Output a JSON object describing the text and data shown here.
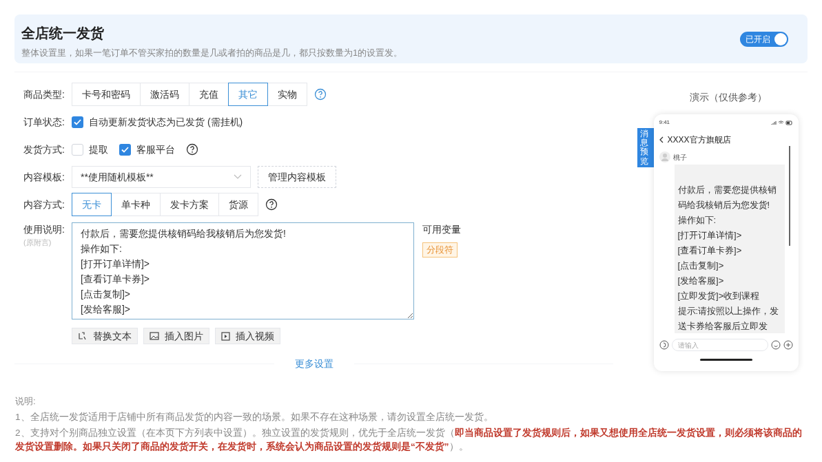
{
  "header": {
    "title": "全店统一发货",
    "subtitle": "整体设置里，如果一笔订单不管买家拍的数量是几或者拍的商品是几，都只按数量为1的设置发。",
    "toggle": {
      "label": "已开启",
      "on": true
    }
  },
  "form": {
    "product_type": {
      "label": "商品类型:",
      "options": [
        {
          "label": "卡号和密码",
          "selected": false
        },
        {
          "label": "激活码",
          "selected": false
        },
        {
          "label": "充值",
          "selected": false
        },
        {
          "label": "其它",
          "selected": true
        },
        {
          "label": "实物",
          "selected": false
        }
      ]
    },
    "order_status": {
      "label": "订单状态:",
      "checkbox": {
        "label": "自动更新发货状态为已发货 (需挂机)",
        "checked": true
      }
    },
    "delivery_method": {
      "label": "发货方式:",
      "checkboxes": [
        {
          "label": "提取",
          "checked": false
        },
        {
          "label": "客服平台",
          "checked": true
        }
      ]
    },
    "content_template": {
      "label": "内容模板:",
      "value": "**使用随机模板**",
      "manage_button": "管理内容模板"
    },
    "content_mode": {
      "label": "内容方式:",
      "options": [
        {
          "label": "无卡",
          "selected": true
        },
        {
          "label": "单卡种",
          "selected": false
        },
        {
          "label": "发卡方案",
          "selected": false
        },
        {
          "label": "货源",
          "selected": false
        }
      ]
    },
    "instructions": {
      "label": "使用说明:",
      "sublabel": "(原附言)",
      "value": "付款后，需要您提供核销码给我核销后为您发货!\n操作如下:\n[打开订单详情]>\n[查看订单卡券]>\n[点击复制]>\n[发给客服]>",
      "variables_title": "可用变量",
      "variables": [
        "分段符"
      ],
      "buttons": [
        {
          "kind": "replace",
          "label": "替换文本"
        },
        {
          "kind": "image",
          "label": "插入图片"
        },
        {
          "kind": "video",
          "label": "插入视频"
        }
      ]
    },
    "more_settings": "更多设置"
  },
  "preview": {
    "title": "演示（仅供参考）",
    "side_tab": "消息预览",
    "time": "9:41",
    "shop": "XXXX官方旗舰店",
    "sender": "桃子",
    "message": [
      "付款后，需要您提供核销码给我核销后为您发货!",
      "操作如下:",
      "[打开订单详情]>",
      "[查看订单卡券]>",
      "[点击复制]>",
      "[发给客服]>",
      "[立即发货]>收到课程",
      "提示:请按照以上操作，发送卡券给客服后立即发"
    ],
    "input_placeholder": "请输入"
  },
  "notes": {
    "title": "说明:",
    "items": [
      "1、全店统一发货适用于店铺中所有商品发货的内容一致的场景。如果不存在这种场景，请勿设置全店统一发货。",
      "2、支持对个别商品独立设置（在本页下方列表中设置）。独立设置的发货规则，优先于全店统一发货（**即当商品设置了发货规则后，如果又想使用全店统一发货设置，则必须将该商品的发货设置删除。如果只关闭了商品的发货开关，在发货时，系统会认为商品设置的发货规则是“不发货”**）。"
    ]
  }
}
